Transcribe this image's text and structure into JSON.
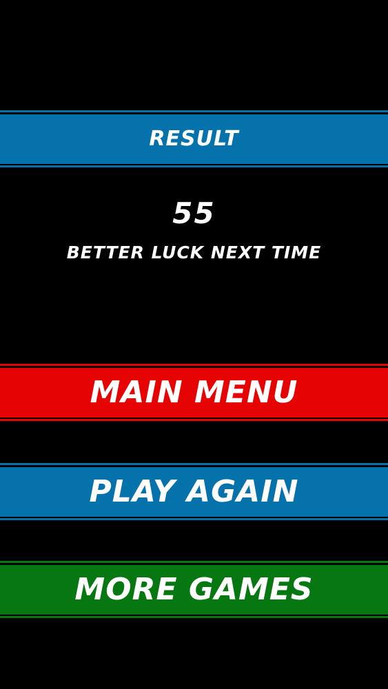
{
  "header": {
    "title": "RESULT"
  },
  "result": {
    "score": "55",
    "message": "BETTER LUCK NEXT TIME"
  },
  "buttons": {
    "main_menu": "MAIN MENU",
    "play_again": "PLAY AGAIN",
    "more_games": "MORE GAMES"
  },
  "colors": {
    "background": "#000000",
    "blue": "#0672ac",
    "red": "#e50303",
    "green": "#077712",
    "text": "#ffffff"
  }
}
